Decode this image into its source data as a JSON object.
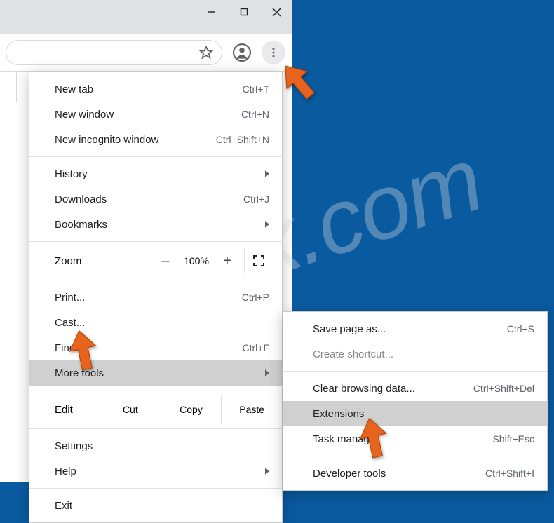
{
  "watermark": "pcrisk.com",
  "window_controls": {
    "minimize": "minimize",
    "maximize": "maximize",
    "close": "close"
  },
  "menu": {
    "group1": [
      {
        "label": "New tab",
        "shortcut": "Ctrl+T"
      },
      {
        "label": "New window",
        "shortcut": "Ctrl+N"
      },
      {
        "label": "New incognito window",
        "shortcut": "Ctrl+Shift+N"
      }
    ],
    "group2": [
      {
        "label": "History",
        "arrow": true
      },
      {
        "label": "Downloads",
        "shortcut": "Ctrl+J"
      },
      {
        "label": "Bookmarks",
        "arrow": true
      }
    ],
    "zoom": {
      "label": "Zoom",
      "minus": "–",
      "value": "100%",
      "plus": "+"
    },
    "group3": [
      {
        "label": "Print...",
        "shortcut": "Ctrl+P"
      },
      {
        "label": "Cast..."
      },
      {
        "label": "Find...",
        "shortcut": "Ctrl+F"
      },
      {
        "label": "More tools",
        "arrow": true,
        "hl": true
      }
    ],
    "edit": {
      "label": "Edit",
      "cut": "Cut",
      "copy": "Copy",
      "paste": "Paste"
    },
    "group4": [
      {
        "label": "Settings"
      },
      {
        "label": "Help",
        "arrow": true
      }
    ],
    "group5": [
      {
        "label": "Exit"
      }
    ]
  },
  "submenu": {
    "group1": [
      {
        "label": "Save page as...",
        "shortcut": "Ctrl+S"
      },
      {
        "label": "Create shortcut..."
      }
    ],
    "group2": [
      {
        "label": "Clear browsing data...",
        "shortcut": "Ctrl+Shift+Del"
      },
      {
        "label": "Extensions",
        "hl": true
      },
      {
        "label": "Task manager",
        "shortcut": "Shift+Esc"
      }
    ],
    "group3": [
      {
        "label": "Developer tools",
        "shortcut": "Ctrl+Shift+I"
      }
    ]
  }
}
